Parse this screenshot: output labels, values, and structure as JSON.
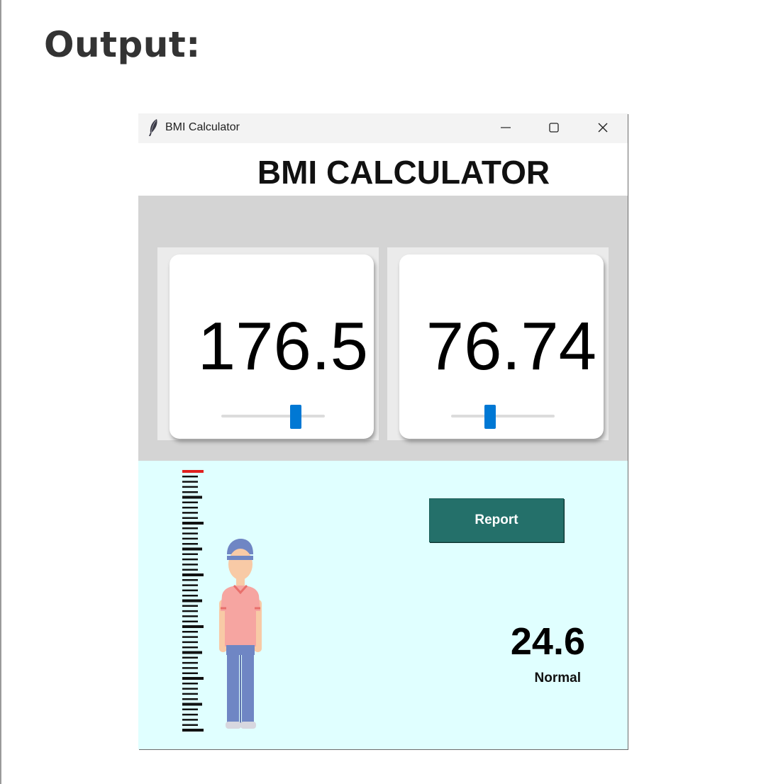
{
  "page": {
    "heading": "Output:"
  },
  "window": {
    "title": "BMI Calculator",
    "icon": "feather-icon",
    "controls": [
      "minimize-icon",
      "maximize-icon",
      "close-icon"
    ]
  },
  "app": {
    "title": "BMI CALCULATOR",
    "height_card": {
      "value": "176.5",
      "slider_fraction": 0.72
    },
    "weight_card": {
      "value": "76.74",
      "slider_fraction": 0.38
    },
    "report_button": "Report",
    "bmi": {
      "value": "24.6",
      "status": "Normal"
    }
  },
  "colors": {
    "accent": "#0078d4",
    "button": "#24706a",
    "panel_gray": "#d4d4d4",
    "result_bg": "#e0ffff",
    "ruler_top": "#e0201e"
  }
}
